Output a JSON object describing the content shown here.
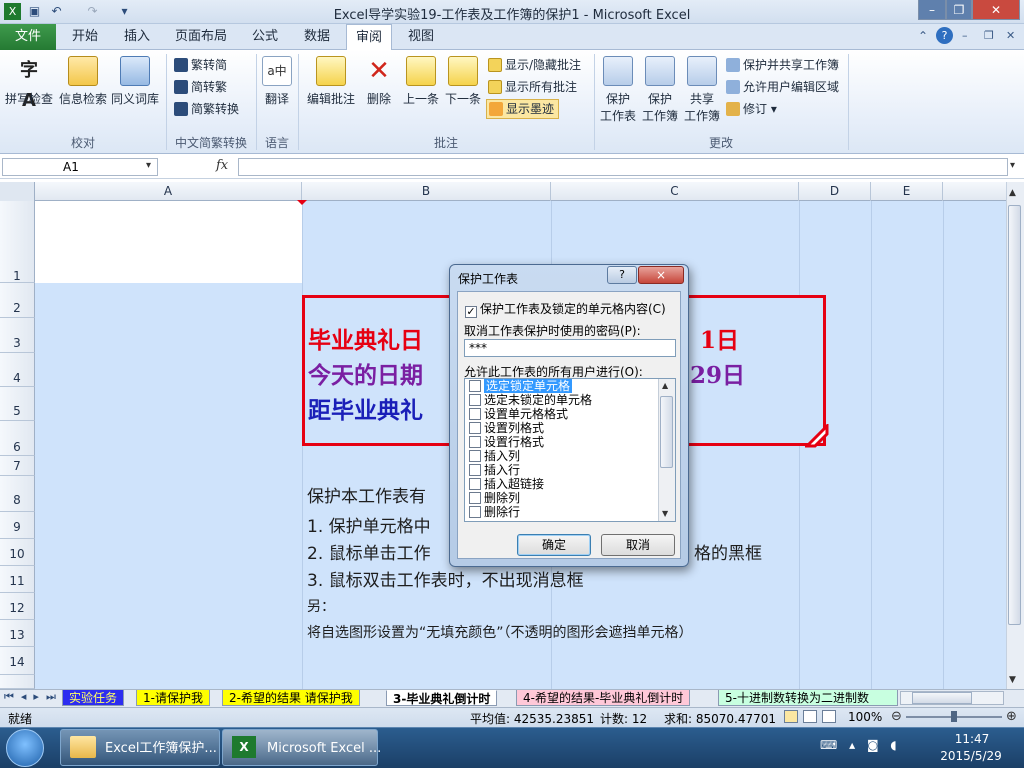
{
  "window": {
    "title": "Excel导学实验19-工作表及工作簿的保护1 - Microsoft Excel"
  },
  "menu": {
    "file_label": "文件",
    "tabs": [
      {
        "label": "开始"
      },
      {
        "label": "插入"
      },
      {
        "label": "页面布局"
      },
      {
        "label": "公式"
      },
      {
        "label": "数据"
      },
      {
        "label": "审阅"
      },
      {
        "label": "视图"
      }
    ]
  },
  "ribbon": {
    "groups": {
      "proofing": "校对",
      "chinese": "中文简繁转换",
      "language": "语言",
      "comments": "批注",
      "changes": "更改"
    },
    "spell_check": "拼写检查",
    "research": "信息检索",
    "thesaurus": "同义词库",
    "to_simplified": "繁转简",
    "to_traditional": "简转繁",
    "conversion": "简繁转换",
    "translate": "翻译",
    "edit_comment": "编辑批注",
    "delete": "删除",
    "previous": "上一条",
    "next": "下一条",
    "show_hide_comment": "显示/隐藏批注",
    "show_all_comments": "显示所有批注",
    "show_ink": "显示墨迹",
    "protect_sheet_1": "保护",
    "protect_sheet_2": "工作表",
    "protect_book_1": "保护",
    "protect_book_2": "工作簿",
    "share_1": "共享",
    "share_2": "工作簿",
    "protect_share": "保护并共享工作簿",
    "allow_edit": "允许用户编辑区域",
    "track": "修订"
  },
  "formula_bar": {
    "name_box": "A1",
    "fx": "fx"
  },
  "columns": [
    "A",
    "B",
    "C",
    "D",
    "E"
  ],
  "rows": [
    "1",
    "2",
    "3",
    "4",
    "5",
    "6",
    "7",
    "8",
    "9",
    "10",
    "11",
    "12",
    "13",
    "14"
  ],
  "sheet": {
    "line1": "毕业典礼日",
    "line1_tail": "1日",
    "line2": "今天的日期",
    "line2_tail": "29日",
    "line3": "距毕业典礼",
    "p8": "保护本工作表有",
    "p9": "1.  保护单元格中",
    "p10": "2.  鼠标单击工作",
    "p10_tail": "格的黑框",
    "p11": "3.  鼠标双击工作表时，不出现消息框",
    "p12": "另：",
    "p13": "将自选图形设置为“无填充颜色”（不透明的图形会遮挡单元格）"
  },
  "sheet_tabs": [
    {
      "label": "实验任务",
      "color": "#2d2df0"
    },
    {
      "label": "1-请保护我",
      "color": "#ffff00"
    },
    {
      "label": "2-希望的结果 请保护我",
      "color": "#ffff00"
    },
    {
      "label": "3-毕业典礼倒计时",
      "color": "#ffffff"
    },
    {
      "label": "4-希望的结果-毕业典礼倒计时",
      "color": "#ffc8d8"
    },
    {
      "label": "5-十进制数转换为二进制数",
      "color": "#c8ffe0"
    }
  ],
  "status": {
    "ready": "就绪",
    "average": "平均值: 42535.23851",
    "count": "计数: 12",
    "sum": "求和: 85070.47701",
    "zoom": "100%"
  },
  "dialog": {
    "title": "保护工作表",
    "protect_label": "保护工作表及锁定的单元格内容(C)",
    "protect_checked": true,
    "password_label": "取消工作表保护时使用的密码(P):",
    "password_value": "***",
    "allow_label": "允许此工作表的所有用户进行(O):",
    "options": [
      {
        "label": "选定锁定单元格",
        "checked": false,
        "selected": true
      },
      {
        "label": "选定未锁定的单元格",
        "checked": false
      },
      {
        "label": "设置单元格格式",
        "checked": false
      },
      {
        "label": "设置列格式",
        "checked": false
      },
      {
        "label": "设置行格式",
        "checked": false
      },
      {
        "label": "插入列",
        "checked": false
      },
      {
        "label": "插入行",
        "checked": false
      },
      {
        "label": "插入超链接",
        "checked": false
      },
      {
        "label": "删除列",
        "checked": false
      },
      {
        "label": "删除行",
        "checked": false
      }
    ],
    "ok": "确定",
    "cancel": "取消",
    "help": "?",
    "close": "×"
  },
  "taskbar": {
    "item1": "Excel工作簿保护...",
    "item2": "Microsoft Excel ...",
    "time": "11:47",
    "date": "2015/5/29"
  }
}
